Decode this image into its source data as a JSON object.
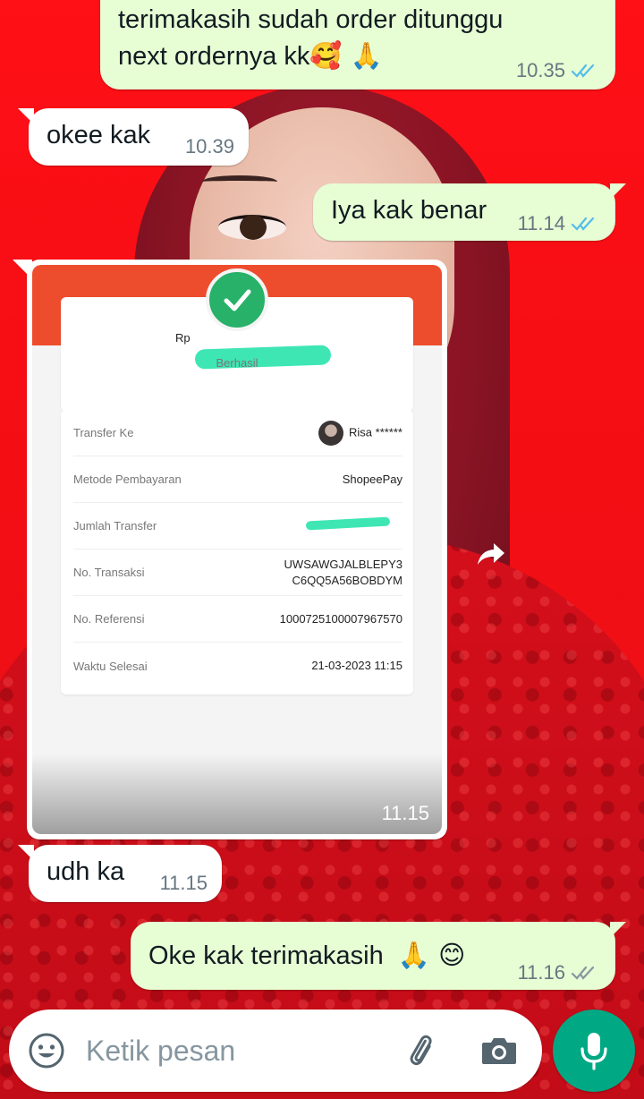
{
  "messages": [
    {
      "direction": "outgoing",
      "text_line1": "terimakasih sudah order ditunggu",
      "text_line2": "next ordernya kk",
      "emoji": "🥰 🙏",
      "time": "10.35",
      "status": "read"
    },
    {
      "direction": "incoming",
      "text": "okee kak",
      "time": "10.39"
    },
    {
      "direction": "outgoing",
      "text": "Iya kak benar",
      "time": "11.14",
      "status": "read"
    },
    {
      "direction": "incoming",
      "type": "image",
      "time": "11.15"
    },
    {
      "direction": "incoming",
      "text": "udh ka",
      "time": "11.15"
    },
    {
      "direction": "outgoing",
      "text": "Oke kak terimakasih",
      "emoji": "🙏 😊",
      "time": "11.16",
      "status": "delivered"
    }
  ],
  "receipt": {
    "amount_prefix": "Rp",
    "status": "Berhasil",
    "rows": [
      {
        "label": "Transfer Ke",
        "value": "Risa ******"
      },
      {
        "label": "Metode Pembayaran",
        "value": "ShopeePay"
      },
      {
        "label": "Jumlah Transfer",
        "value": ""
      },
      {
        "label": "No. Transaksi",
        "value_line1": "UWSAWGJALBLEPY3",
        "value_line2": "C6QQ5A56BOBDYM"
      },
      {
        "label": "No. Referensi",
        "value": "1000725100007967570"
      },
      {
        "label": "Waktu Selesai",
        "value": "21-03-2023 11:15"
      }
    ]
  },
  "input": {
    "placeholder": "Ketik pesan"
  },
  "colors": {
    "outgoing_bubble": "#e7fdd4",
    "incoming_bubble": "#ffffff",
    "read_ticks": "#53bdeb",
    "delivered_ticks": "#8696a0",
    "mic_button": "#00a884",
    "shopee_orange": "#ee4d2d",
    "success_green": "#27b169"
  },
  "icons": [
    "emoji-icon",
    "attach-icon",
    "camera-icon",
    "mic-icon",
    "forward-icon",
    "check-icon",
    "double-tick-icon"
  ]
}
